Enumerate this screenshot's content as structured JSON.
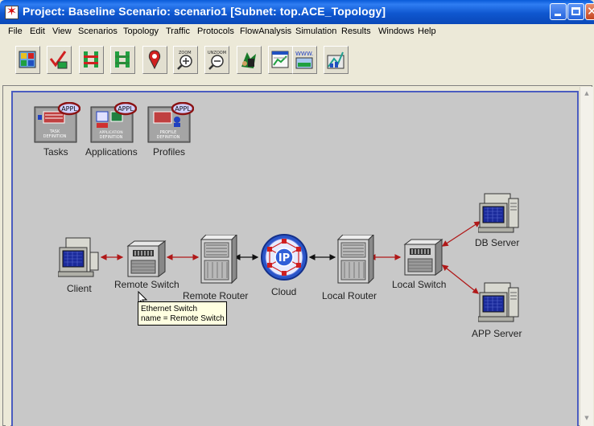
{
  "window": {
    "title": "Project: Baseline Scenario: scenario1  [Subnet: top.ACE_Topology]"
  },
  "menu": {
    "items": [
      "File",
      "Edit",
      "View",
      "Scenarios",
      "Topology",
      "Traffic",
      "Protocols",
      "FlowAnalysis",
      "Simulation",
      "Results",
      "Windows",
      "Help"
    ]
  },
  "toolbar": {
    "buttons": [
      {
        "icon": "open-object-palette-icon"
      },
      {
        "icon": "check-link-consistency-icon"
      },
      {
        "icon": "fail-selected-objects-icon"
      },
      {
        "icon": "recover-selected-objects-icon"
      },
      {
        "icon": "return-to-parent-subnet-icon"
      },
      {
        "icon": "zoom-in-icon",
        "caption": "ZOOM"
      },
      {
        "icon": "zoom-out-icon",
        "caption": "UNZOOM"
      },
      {
        "icon": "configure-discrete-event-simulation-icon"
      },
      {
        "icon": "view-results-icon"
      },
      {
        "icon": "view-web-reports-icon",
        "caption": "WWW."
      },
      {
        "icon": "hide-or-show-graph-panels-icon"
      }
    ]
  },
  "config_objects": [
    {
      "badge": "APPL",
      "inner": "TASK\nDEFINITION",
      "label": "Tasks"
    },
    {
      "badge": "APPL",
      "inner": "APPLICATION\nDEFINITION",
      "label": "Applications"
    },
    {
      "badge": "APPL",
      "inner": "PROFILE\nDEFINITION",
      "label": "Profiles"
    }
  ],
  "nodes": {
    "client": "Client",
    "remote_switch": "Remote Switch",
    "remote_router": "Remote Router",
    "cloud": "Cloud",
    "cloud_badge": "IP",
    "local_router": "Local Router",
    "local_switch": "Local Switch",
    "db_server": "DB Server",
    "app_server": "APP Server"
  },
  "tooltip": {
    "line1": "Ethernet Switch",
    "line2": "name = Remote Switch"
  },
  "colors": {
    "titlebar": "#0a5bd8",
    "canvas": "#c8c8c8",
    "canvas_border": "#4a5cc0",
    "link": "#b01818",
    "appl_ring": "#8b1212"
  }
}
